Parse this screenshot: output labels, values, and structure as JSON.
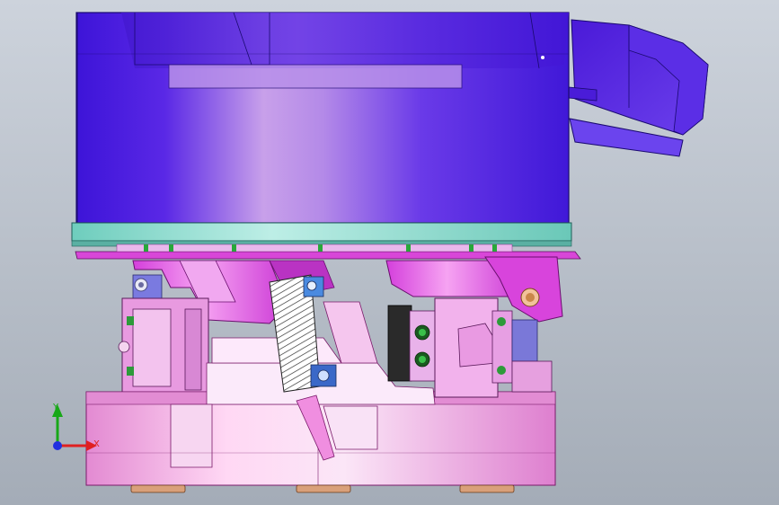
{
  "viewport": {
    "background_top": "#cdd3dc",
    "background_bottom": "#a4acb7"
  },
  "model": {
    "colors": {
      "bowl": "#4b1fe0",
      "bowl_highlight": "#c79ae6",
      "ring": "#7fd6c8",
      "bracket": "#e04fe6",
      "base": "#f0a6e0",
      "base_highlight": "#ffe3f7",
      "fastener": "#2d9a3a"
    }
  },
  "triad": {
    "x_label": "X",
    "y_label": "Y",
    "x_color": "#e02020",
    "y_color": "#18a818",
    "z_color": "#2030e0"
  }
}
